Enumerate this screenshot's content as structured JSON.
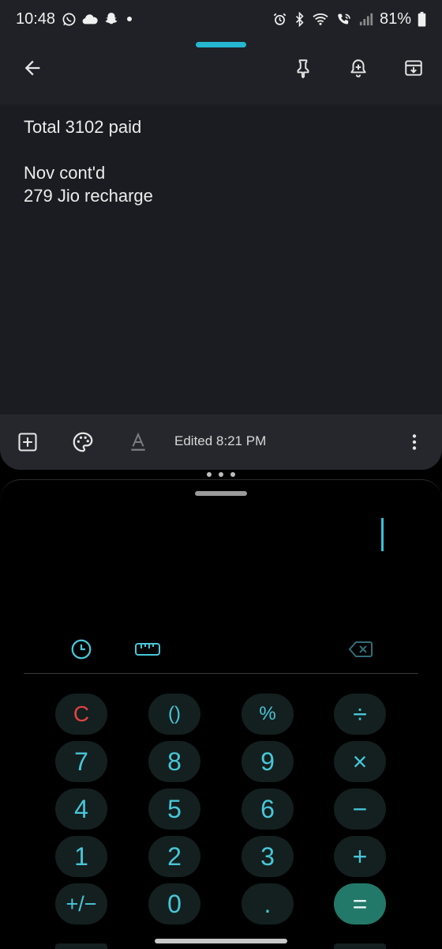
{
  "status_bar": {
    "time": "10:48",
    "battery": "81%",
    "left_icons": [
      "whatsapp-icon",
      "cloud-icon",
      "snapchat-icon",
      "dot-icon"
    ],
    "right_icons": [
      "alarm-icon",
      "bluetooth-icon",
      "wifi-icon",
      "wifi-calling-icon",
      "signal-icon",
      "battery-icon"
    ]
  },
  "notes": {
    "toolbar_icons": [
      "back-arrow-icon",
      "pin-icon",
      "reminder-bell-icon",
      "archive-icon"
    ],
    "lines": [
      "Total 3102 paid",
      "",
      "Nov cont'd",
      "279 Jio recharge"
    ],
    "edited_label": "Edited 8:21 PM",
    "bottom_icons": [
      "add-box-icon",
      "palette-icon",
      "text-format-icon",
      "more-vert-icon"
    ]
  },
  "calculator": {
    "display_value": "",
    "tools": [
      "history-icon",
      "ruler-icon",
      "backspace-icon"
    ],
    "keys": [
      [
        "C",
        "()",
        "%",
        "÷"
      ],
      [
        "7",
        "8",
        "9",
        "×"
      ],
      [
        "4",
        "5",
        "6",
        "−"
      ],
      [
        "1",
        "2",
        "3",
        "+"
      ],
      [
        "+/−",
        "0",
        ".",
        "="
      ]
    ]
  },
  "colors": {
    "accent_cyan": "#48c6d9",
    "clear_red": "#e14343",
    "equals_green": "#237969",
    "notes_bg": "#1f2126",
    "key_bg": "#13201f"
  }
}
